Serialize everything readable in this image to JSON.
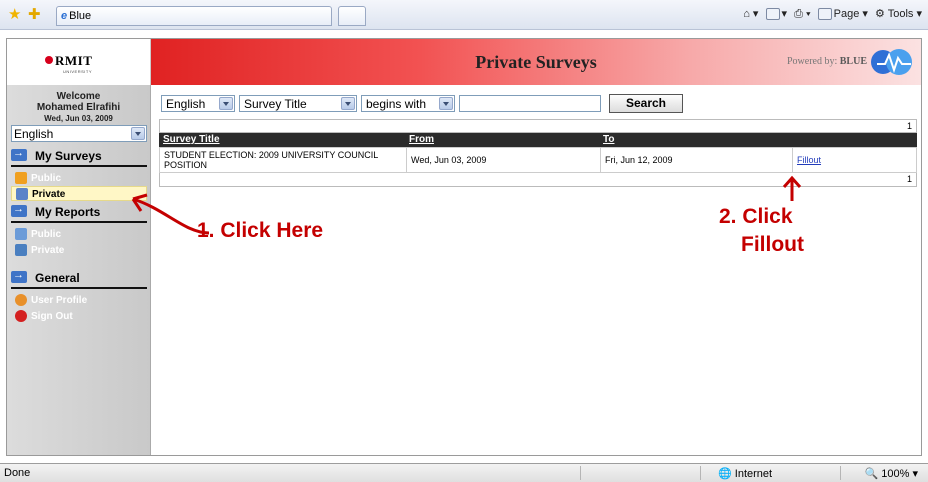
{
  "browser": {
    "tab_title": "Blue",
    "toolbar": {
      "page_label": "Page",
      "tools_label": "Tools"
    }
  },
  "header": {
    "logo_text": "RMIT",
    "logo_subtext": "UNIVERSITY",
    "title": "Private Surveys",
    "powered_label": "Powered by:",
    "powered_brand": "BLUE"
  },
  "sidebar": {
    "welcome": "Welcome",
    "user_name": "Mohamed Elrafihi",
    "date": "Wed, Jun 03, 2009",
    "language": "English",
    "sections": [
      {
        "title": "My Surveys",
        "items": [
          {
            "label": "Public"
          },
          {
            "label": "Private"
          }
        ]
      },
      {
        "title": "My Reports",
        "items": [
          {
            "label": "Public"
          },
          {
            "label": "Private"
          }
        ]
      },
      {
        "title": "General",
        "items": [
          {
            "label": "User Profile"
          },
          {
            "label": "Sign Out"
          }
        ]
      }
    ]
  },
  "filters": {
    "language": "English",
    "field": "Survey Title",
    "operator": "begins with",
    "search_value": "",
    "search_button": "Search"
  },
  "table": {
    "page_count_top": "1",
    "page_count_bottom": "1",
    "columns": [
      "Survey Title",
      "From",
      "To"
    ],
    "rows": [
      {
        "title": "STUDENT ELECTION: 2009 UNIVERSITY COUNCIL POSITION",
        "from": "Wed, Jun 03, 2009",
        "to": "Fri, Jun 12, 2009",
        "action": "Fillout"
      }
    ]
  },
  "annotations": {
    "step1": "1. Click Here",
    "step2_line1": "2. Click",
    "step2_line2": "Fillout"
  },
  "statusbar": {
    "status": "Done",
    "zone": "Internet",
    "zoom": "100%"
  },
  "colors": {
    "header_red": "#e02222",
    "annotation_red": "#c40000",
    "link_blue": "#223cbb",
    "active_item_bg": "#fff7c6"
  }
}
